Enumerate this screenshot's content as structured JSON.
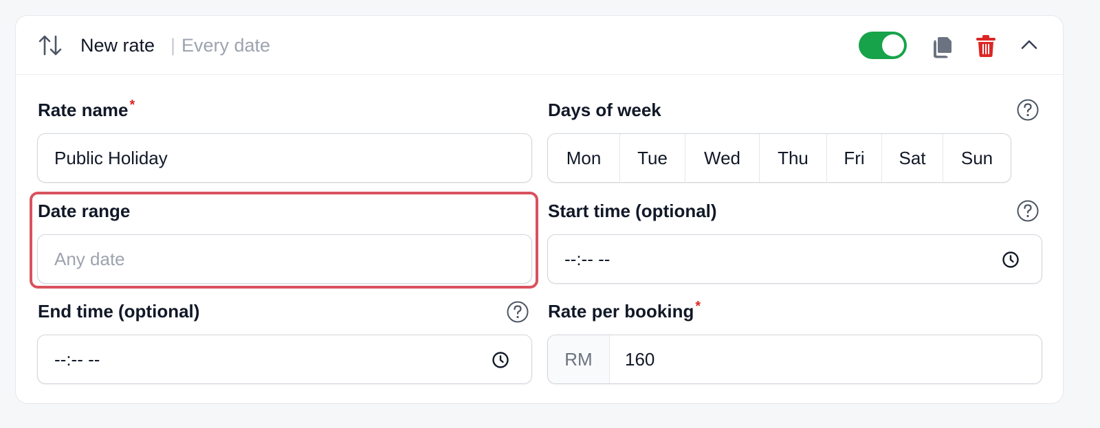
{
  "header": {
    "title": "New rate",
    "separator": "|",
    "subtitle": "Every date",
    "enabled": true,
    "toggle_color": "#16a34a",
    "icons": [
      "sort-icon",
      "copy-icon",
      "trash-icon",
      "chevron-up-icon"
    ]
  },
  "rate_name": {
    "label": "Rate name",
    "required_mark": "*",
    "value": "Public Holiday"
  },
  "days_of_week": {
    "label": "Days of week",
    "days": [
      "Mon",
      "Tue",
      "Wed",
      "Thu",
      "Fri",
      "Sat",
      "Sun"
    ]
  },
  "date_range": {
    "label": "Date range",
    "placeholder": "Any date",
    "highlight_color": "#d9525e"
  },
  "start_time": {
    "label": "Start time (optional)",
    "value": "--:-- --"
  },
  "end_time": {
    "label": "End time (optional)",
    "value": "--:-- --"
  },
  "rate_per_booking": {
    "label": "Rate per booking",
    "required_mark": "*",
    "currency": "RM",
    "value": "160"
  }
}
